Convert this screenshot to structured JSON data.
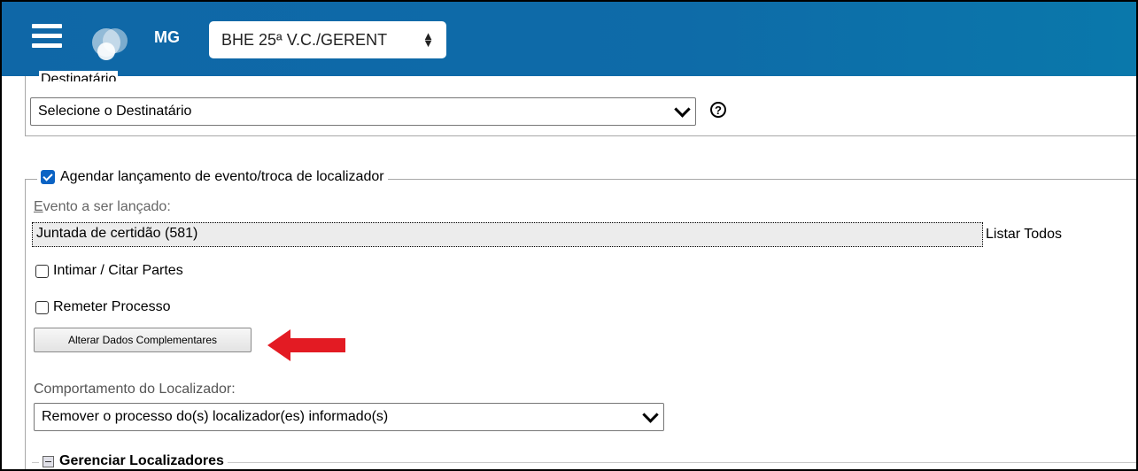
{
  "header": {
    "state": "MG",
    "unit_selected": "BHE 25ª V.C./GERENT"
  },
  "destinatario": {
    "legend": "Destinatário",
    "selected": "Selecione o Destinatário",
    "help_symbol": "?"
  },
  "agendamento": {
    "legend": "Agendar lançamento de evento/troca de localizador",
    "checked": true,
    "evento_label_first": "E",
    "evento_label_rest": "vento a ser lançado:",
    "evento_value": "Juntada de certidão (581)",
    "listar_todos": "Listar Todos",
    "intimar_label": "Intimar / Citar Partes",
    "remeter_label": "Remeter Processo",
    "alterar_button": "Alterar Dados Complementares",
    "comportamento_label": "Comportamento do Localizador:",
    "comportamento_selected": "Remover o processo do(s) localizador(es) informado(s)",
    "gerenciar_label": "Gerenciar Localizadores"
  },
  "colors": {
    "header_bg": "#0f67a7",
    "checkbox_blue": "#0b63c4",
    "annotation_arrow": "#e31b23"
  },
  "icons": [
    "menu-icon",
    "logo-icon",
    "sort-arrows-icon",
    "chevron-down-icon",
    "help-icon",
    "checkbox-checked-icon",
    "checkbox-empty-icon",
    "red-arrow-annotation",
    "collapse-minus-icon"
  ]
}
